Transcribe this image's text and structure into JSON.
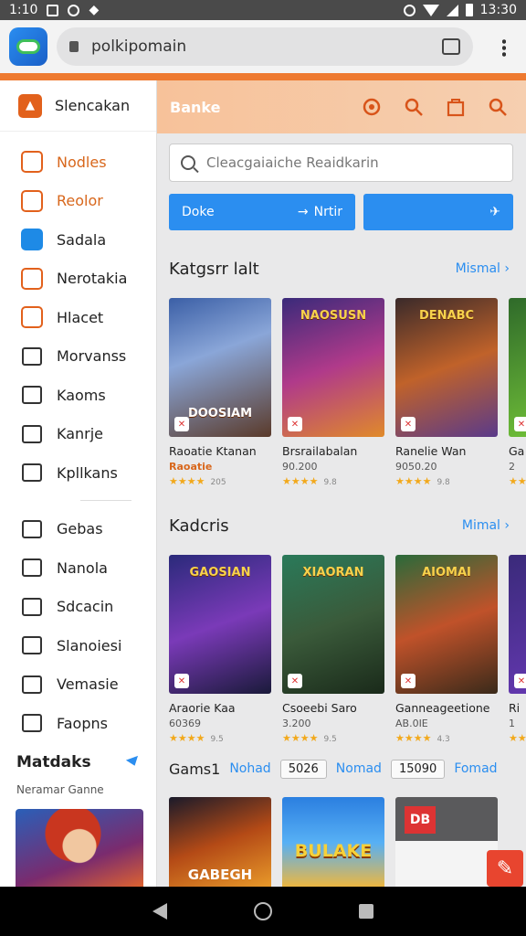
{
  "status_bar": {
    "time_left": "1:10",
    "time_right": "13:30"
  },
  "browser": {
    "url": "polkipomain"
  },
  "sidebar": {
    "header": "Slencakan",
    "items": [
      {
        "label": "Nodles",
        "icon": "game-controller-icon",
        "highlight": true
      },
      {
        "label": "Reolor",
        "icon": "tag-icon",
        "highlight": true
      },
      {
        "label": "Sadala",
        "icon": "compass-icon",
        "highlight": false
      },
      {
        "label": "Nerotakia",
        "icon": "chart-icon",
        "highlight": false
      },
      {
        "label": "Hlacet",
        "icon": "bookmark-icon",
        "highlight": false
      },
      {
        "label": "Morvanss",
        "icon": "grid-icon",
        "highlight": false
      },
      {
        "label": "Kaoms",
        "icon": "cloud-icon",
        "highlight": false
      },
      {
        "label": "Kanrje",
        "icon": "mail-icon",
        "highlight": false
      },
      {
        "label": "Kpllkans",
        "icon": "chat-icon",
        "highlight": false
      }
    ],
    "items2": [
      {
        "label": "Gebas",
        "icon": "list-icon"
      },
      {
        "label": "Nanola",
        "icon": "home-icon"
      },
      {
        "label": "Sdcacin",
        "icon": "bar-chart-icon"
      },
      {
        "label": "Slanoiesi",
        "icon": "board-icon"
      },
      {
        "label": "Vemasie",
        "icon": "user-icon"
      },
      {
        "label": "Faopns",
        "icon": "keyboard-icon"
      }
    ],
    "section_title": "Matdaks",
    "section_sub": "Neramar Ganne"
  },
  "main": {
    "header_title": "Banke",
    "search_placeholder": "Cleacgaiaiche Reaidkarin",
    "button1": "Doke",
    "button1_right": "Nrtir",
    "section1": {
      "title": "Katgsrr lalt",
      "more": "Mismal",
      "cards": [
        {
          "name": "Raoatie Ktanan",
          "meta": "Raoatie",
          "stars": "★★★★",
          "count": "205",
          "logo": "DOOSIAM",
          "meta_red": true
        },
        {
          "name": "Brsrailabalan",
          "meta": "90.200",
          "stars": "★★★★",
          "count": "9.8",
          "logo": "NAOSUSN",
          "meta_red": false
        },
        {
          "name": "Ranelie Wan",
          "meta": "9050.20",
          "stars": "★★★★",
          "count": "9.8",
          "logo": "DENABC",
          "meta_red": false
        },
        {
          "name": "Ga",
          "meta": "2",
          "stars": "★★",
          "count": "",
          "logo": "",
          "meta_red": false
        }
      ]
    },
    "section2": {
      "title": "Kadcris",
      "more": "Mimal",
      "cards": [
        {
          "name": "Araorie Kaa",
          "meta": "60369",
          "stars": "★★★★",
          "count": "9.5",
          "logo": "GAOSIAN"
        },
        {
          "name": "Csoeebi Saro",
          "meta": "3.200",
          "stars": "★★★★",
          "count": "9.5",
          "logo": "XIAORAN"
        },
        {
          "name": "Ganneageetione",
          "meta": "AB.0IE",
          "stars": "★★★★",
          "count": "4.3",
          "logo": "AIOMAI"
        },
        {
          "name": "Ri",
          "meta": "1",
          "stars": "★★",
          "count": "",
          "logo": ""
        }
      ]
    },
    "games_row": {
      "label": "Gams1",
      "link1": "Nohad",
      "box1": "5026",
      "link2": "Nomad",
      "box2": "15090",
      "link3": "Fomad"
    },
    "bottom_logos": [
      "GABEGH",
      "BULAKE",
      "DB"
    ]
  }
}
